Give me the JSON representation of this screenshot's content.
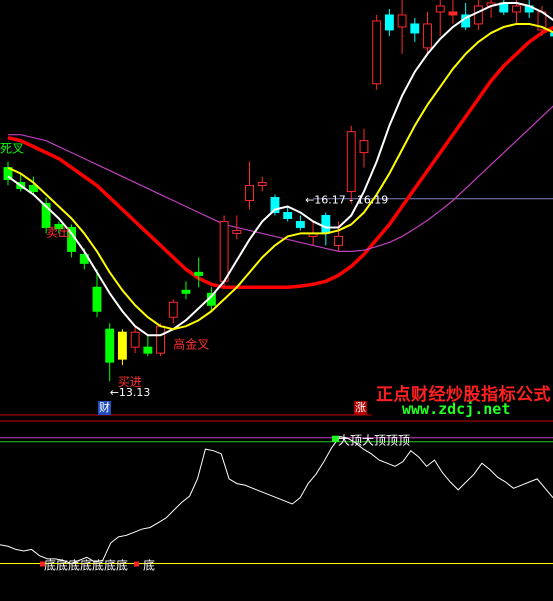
{
  "colors": {
    "background": "#000000",
    "up_candle": "#ff2a2a",
    "down_candle": "#00ffff",
    "green_candle": "#00ff00",
    "yellow_candle": "#ffff00",
    "ma_white": "#ffffff",
    "ma_yellow": "#ffff00",
    "ma_red": "#ff0000",
    "ma_magenta": "#c040c0",
    "divider": "#c00000",
    "indicator_line": "#ffffff",
    "indicator_top_band": "#c040c0",
    "indicator_bottom_band": "#ffff00"
  },
  "watermark": {
    "title": "正点财经炒股指标公式",
    "url": "www.zdcj.net"
  },
  "badges": {
    "left": "财",
    "right": "涨"
  },
  "chart_data": [
    {
      "type": "candlestick",
      "title": "",
      "ylim": [
        12.6,
        19.5
      ],
      "annotations": [
        {
          "text": "死叉",
          "candle": 0
        },
        {
          "text": "卖出",
          "candle": 3
        },
        {
          "text": "高金叉",
          "candle": 13
        },
        {
          "text": "买进",
          "candle": 8
        },
        {
          "text": "←13.13",
          "candle": 8
        },
        {
          "text": "←16.17 - 16.19",
          "candle": 24
        }
      ],
      "candles": [
        {
          "open": 16.7,
          "close": 16.5,
          "high": 16.8,
          "low": 16.4,
          "color": "green"
        },
        {
          "open": 16.45,
          "close": 16.35,
          "high": 16.6,
          "low": 16.3,
          "color": "green"
        },
        {
          "open": 16.4,
          "close": 16.3,
          "high": 16.55,
          "low": 16.25,
          "color": "green"
        },
        {
          "open": 16.1,
          "close": 15.7,
          "high": 16.2,
          "low": 15.6,
          "color": "green"
        },
        {
          "open": 15.75,
          "close": 15.68,
          "high": 15.8,
          "low": 15.6,
          "color": "green"
        },
        {
          "open": 15.7,
          "close": 15.3,
          "high": 15.75,
          "low": 15.2,
          "color": "green"
        },
        {
          "open": 15.25,
          "close": 15.1,
          "high": 15.35,
          "low": 15.0,
          "color": "green"
        },
        {
          "open": 14.7,
          "close": 14.3,
          "high": 15.0,
          "low": 14.2,
          "color": "green"
        },
        {
          "open": 14.0,
          "close": 13.45,
          "high": 14.1,
          "low": 13.13,
          "color": "green"
        },
        {
          "open": 13.5,
          "close": 13.95,
          "high": 14.0,
          "low": 13.4,
          "color": "yellow"
        },
        {
          "open": 13.7,
          "close": 13.95,
          "high": 14.05,
          "low": 13.6,
          "color": "red"
        },
        {
          "open": 13.7,
          "close": 13.6,
          "high": 13.9,
          "low": 13.55,
          "color": "green"
        },
        {
          "open": 13.6,
          "close": 14.05,
          "high": 14.1,
          "low": 13.55,
          "color": "red"
        },
        {
          "open": 14.2,
          "close": 14.45,
          "high": 14.5,
          "low": 14.1,
          "color": "red"
        },
        {
          "open": 14.6,
          "close": 14.65,
          "high": 14.8,
          "low": 14.5,
          "color": "green"
        },
        {
          "open": 14.9,
          "close": 14.95,
          "high": 15.2,
          "low": 14.7,
          "color": "green"
        },
        {
          "open": 14.4,
          "close": 14.6,
          "high": 14.7,
          "low": 14.3,
          "color": "green"
        },
        {
          "open": 14.8,
          "close": 15.8,
          "high": 15.9,
          "low": 14.7,
          "color": "red"
        },
        {
          "open": 15.6,
          "close": 15.65,
          "high": 15.9,
          "low": 15.5,
          "color": "red"
        },
        {
          "open": 16.15,
          "close": 16.4,
          "high": 16.8,
          "low": 16.0,
          "color": "red"
        },
        {
          "open": 16.4,
          "close": 16.45,
          "high": 16.55,
          "low": 16.3,
          "color": "red"
        },
        {
          "open": 16.2,
          "close": 15.95,
          "high": 16.25,
          "low": 15.9,
          "color": "cyan"
        },
        {
          "open": 15.95,
          "close": 15.85,
          "high": 16.05,
          "low": 15.8,
          "color": "cyan"
        },
        {
          "open": 15.8,
          "close": 15.7,
          "high": 15.9,
          "low": 15.65,
          "color": "cyan"
        },
        {
          "open": 15.55,
          "close": 15.6,
          "high": 15.8,
          "low": 15.4,
          "color": "red"
        },
        {
          "open": 15.9,
          "close": 15.6,
          "high": 15.95,
          "low": 15.4,
          "color": "cyan"
        },
        {
          "open": 15.4,
          "close": 15.55,
          "high": 15.8,
          "low": 15.3,
          "color": "red"
        },
        {
          "open": 16.3,
          "close": 17.3,
          "high": 17.4,
          "low": 16.1,
          "color": "red"
        },
        {
          "open": 16.95,
          "close": 17.15,
          "high": 17.35,
          "low": 16.7,
          "color": "red"
        },
        {
          "open": 18.1,
          "close": 19.15,
          "high": 19.25,
          "low": 18.0,
          "color": "red"
        },
        {
          "open": 19.25,
          "close": 19.0,
          "high": 19.35,
          "low": 18.9,
          "color": "cyan"
        },
        {
          "open": 19.05,
          "close": 19.25,
          "high": 19.5,
          "low": 18.6,
          "color": "red"
        },
        {
          "open": 19.1,
          "close": 18.95,
          "high": 19.2,
          "low": 18.8,
          "color": "cyan"
        },
        {
          "open": 18.7,
          "close": 19.1,
          "high": 19.3,
          "low": 18.6,
          "color": "red"
        },
        {
          "open": 19.3,
          "close": 19.4,
          "high": 19.5,
          "low": 18.9,
          "color": "red"
        },
        {
          "open": 19.3,
          "close": 19.25,
          "high": 19.5,
          "low": 19.1,
          "color": "red"
        },
        {
          "open": 19.25,
          "close": 19.05,
          "high": 19.45,
          "low": 19.0,
          "color": "cyan"
        },
        {
          "open": 19.1,
          "close": 19.4,
          "high": 19.5,
          "low": 19.0,
          "color": "red"
        },
        {
          "open": 19.4,
          "close": 19.45,
          "high": 19.5,
          "low": 19.2,
          "color": "red"
        },
        {
          "open": 19.45,
          "close": 19.3,
          "high": 19.5,
          "low": 19.25,
          "color": "cyan"
        },
        {
          "open": 19.3,
          "close": 19.4,
          "high": 19.5,
          "low": 19.1,
          "color": "red"
        },
        {
          "open": 19.4,
          "close": 19.3,
          "high": 19.5,
          "low": 19.2,
          "color": "cyan"
        },
        {
          "open": 19.0,
          "close": 19.3,
          "high": 19.4,
          "low": 18.9,
          "color": "red"
        },
        {
          "open": 18.95,
          "close": 18.9,
          "high": 19.05,
          "low": 18.8,
          "color": "cyan"
        }
      ],
      "series": [
        {
          "color": "white",
          "values": [
            16.55,
            16.4,
            16.25,
            16.05,
            15.85,
            15.6,
            15.3,
            14.95,
            14.6,
            14.3,
            14.05,
            13.9,
            13.9,
            14.0,
            14.15,
            14.35,
            14.55,
            14.8,
            15.15,
            15.5,
            15.8,
            16.0,
            16.05,
            15.95,
            15.8,
            15.7,
            15.7,
            15.9,
            16.3,
            16.8,
            17.4,
            17.9,
            18.3,
            18.6,
            18.85,
            19.05,
            19.2,
            19.3,
            19.4,
            19.45,
            19.45,
            19.4,
            19.3,
            19.15
          ]
        },
        {
          "color": "yellow",
          "values": [
            16.7,
            16.6,
            16.45,
            16.25,
            16.05,
            15.85,
            15.6,
            15.3,
            14.95,
            14.65,
            14.4,
            14.2,
            14.05,
            14.0,
            14.05,
            14.15,
            14.3,
            14.5,
            14.7,
            14.95,
            15.2,
            15.4,
            15.55,
            15.6,
            15.6,
            15.6,
            15.65,
            15.75,
            15.95,
            16.25,
            16.6,
            17.0,
            17.4,
            17.75,
            18.05,
            18.35,
            18.6,
            18.8,
            18.95,
            19.05,
            19.1,
            19.1,
            19.05,
            18.95
          ]
        },
        {
          "color": "red",
          "values": [
            17.2,
            17.15,
            17.05,
            16.95,
            16.85,
            16.7,
            16.55,
            16.4,
            16.2,
            16.0,
            15.8,
            15.6,
            15.4,
            15.2,
            15.0,
            14.85,
            14.75,
            14.7,
            14.7,
            14.7,
            14.7,
            14.7,
            14.7,
            14.72,
            14.75,
            14.8,
            14.9,
            15.05,
            15.25,
            15.5,
            15.75,
            16.05,
            16.35,
            16.65,
            16.95,
            17.25,
            17.55,
            17.85,
            18.15,
            18.4,
            18.6,
            18.8,
            18.95,
            19.05
          ]
        },
        {
          "color": "magenta",
          "values": [
            17.25,
            17.25,
            17.2,
            17.15,
            17.05,
            16.95,
            16.85,
            16.75,
            16.65,
            16.55,
            16.45,
            16.35,
            16.25,
            16.15,
            16.05,
            15.95,
            15.85,
            15.75,
            15.7,
            15.65,
            15.6,
            15.55,
            15.5,
            15.45,
            15.4,
            15.35,
            15.3,
            15.3,
            15.32,
            15.38,
            15.45,
            15.55,
            15.68,
            15.82,
            15.98,
            16.15,
            16.35,
            16.55,
            16.75,
            16.95,
            17.15,
            17.35,
            17.55,
            17.75
          ]
        }
      ],
      "reference_line": {
        "value": 16.18,
        "label": "16.17 - 16.19"
      }
    },
    {
      "type": "line",
      "title": "",
      "ylim": [
        0,
        100
      ],
      "top_label": "大顶大顶顶顶",
      "bottom_label": "底底底底底底底",
      "bottom_label_2": "底",
      "top_band": 97,
      "bottom_band": 18,
      "values": [
        30,
        29,
        27,
        26,
        27,
        23,
        21,
        21,
        20,
        18,
        20,
        22,
        19,
        20,
        31,
        35,
        36,
        38,
        40,
        41,
        44,
        47,
        52,
        57,
        61,
        72,
        91,
        90,
        88,
        72,
        69,
        68,
        66,
        64,
        62,
        60,
        58,
        56,
        60,
        69,
        75,
        83,
        92,
        99,
        98,
        95,
        91,
        88,
        84,
        82,
        80,
        83,
        90,
        86,
        80,
        84,
        76,
        70,
        65,
        70,
        75,
        82,
        78,
        73,
        70,
        66,
        68,
        70,
        72,
        66,
        60
      ]
    }
  ]
}
